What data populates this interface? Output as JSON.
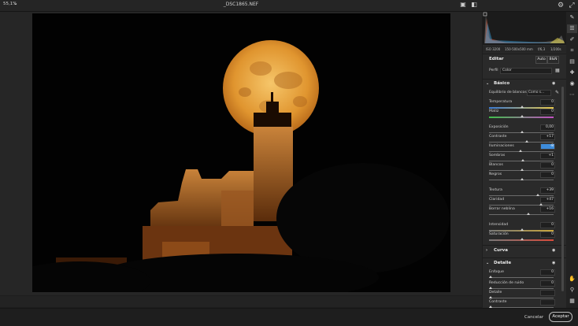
{
  "window": {
    "title": "_DSC1865.NEF"
  },
  "canvas": {
    "zoom": "55,1%"
  },
  "footer": {
    "cancel_label": "Cancelar",
    "accept_label": "Aceptar"
  },
  "exif": {
    "camera": "ISO 3200",
    "lens": "150-500x500 mm",
    "aperture": "f/6,3",
    "shutter": "1/200s"
  },
  "panel": {
    "edit_title": "Editar",
    "auto_label": "Auto",
    "bw_label": "B&N",
    "profile_label": "Perfil",
    "profile_value": "Color",
    "basic": {
      "title": "Básico",
      "wb_label": "Equilibrio de blancos",
      "wb_value": "Como s...",
      "sliders": [
        {
          "label": "Temperatura",
          "value": "0"
        },
        {
          "label": "Matiz",
          "value": "0"
        },
        {
          "label": "Exposición",
          "value": "0,00"
        },
        {
          "label": "Contraste",
          "value": "+17"
        },
        {
          "label": "Iluminaciones",
          "value": "-8"
        },
        {
          "label": "Sombras",
          "value": "+1"
        },
        {
          "label": "Blancos",
          "value": "0"
        },
        {
          "label": "Negros",
          "value": "0"
        },
        {
          "label": "Textura",
          "value": "+39"
        },
        {
          "label": "Claridad",
          "value": "+47"
        },
        {
          "label": "Borrar neblina",
          "value": "+16"
        },
        {
          "label": "Intensidad",
          "value": "0"
        },
        {
          "label": "Saturación",
          "value": "0"
        }
      ]
    },
    "curve_title": "Curva",
    "detail": {
      "title": "Detalle",
      "sliders": [
        {
          "label": "Enfoque",
          "value": "0"
        },
        {
          "label": "Reducción de ruido",
          "value": "0"
        },
        {
          "label": "Detalle",
          "value": ""
        },
        {
          "label": "Contraste",
          "value": ""
        }
      ]
    }
  },
  "colors": {
    "moon": "#e6a23c",
    "accent": "#3d8bd9"
  }
}
